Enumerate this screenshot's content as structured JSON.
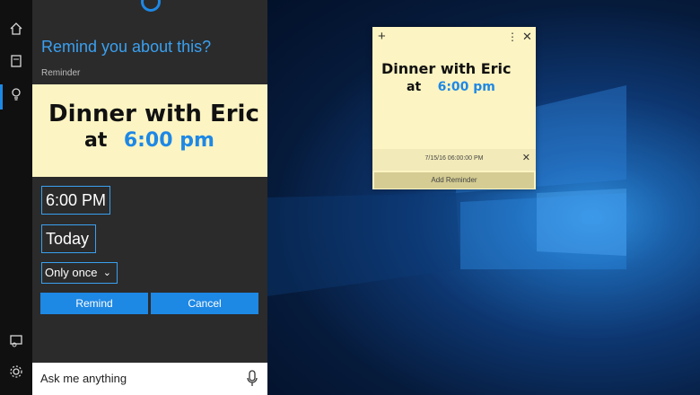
{
  "cortana": {
    "title": "Remind you about this?",
    "subtitle": "Reminder",
    "note_line1": "Dinner with Eric",
    "note_line2_prefix": "at",
    "note_line2_time": "6:00 pm",
    "time_value": "6:00 PM",
    "date_value": "Today",
    "repeat_value": "Only once",
    "remind_label": "Remind",
    "cancel_label": "Cancel",
    "ask_placeholder": "Ask me anything"
  },
  "sticky": {
    "note_line1": "Dinner with Eric",
    "note_line2_prefix": "at",
    "note_line2_time": "6:00 pm",
    "reminder_datetime": "7/15/16 06:00:00 PM",
    "add_reminder_label": "Add Reminder"
  },
  "icons": [
    "home-icon",
    "notebook-icon",
    "lightbulb-icon",
    "feedback-icon",
    "settings-icon",
    "microphone-icon",
    "plus-icon",
    "more-icon",
    "close-icon"
  ],
  "colors": {
    "accent": "#1e88e5",
    "sticky_yellow": "#fcf4c2",
    "panel": "#2b2b2b",
    "rail": "#101010"
  }
}
